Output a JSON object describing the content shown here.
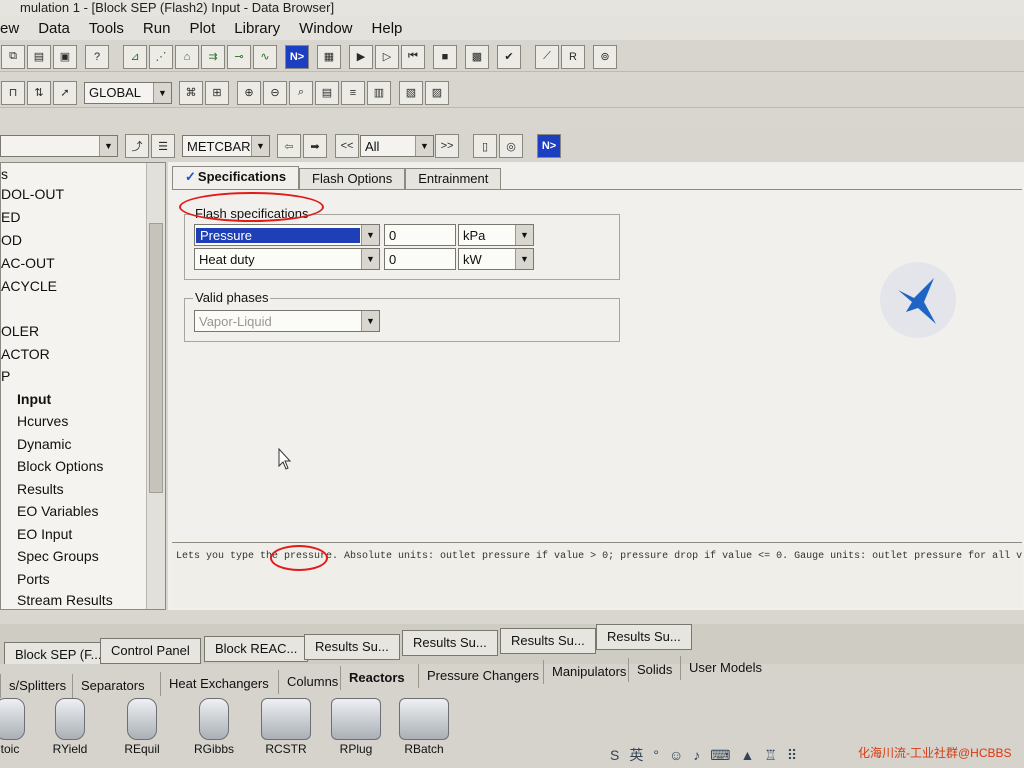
{
  "window": {
    "title": "mulation 1 - [Block SEP (Flash2) Input - Data Browser]"
  },
  "menu": [
    "ew",
    "Data",
    "Tools",
    "Run",
    "Plot",
    "Library",
    "Window",
    "Help"
  ],
  "toolbar": {
    "scope_value": "GLOBAL"
  },
  "navbar": {
    "units_value": "METCBAR",
    "filter_value": "All",
    "back_label": "<<",
    "forward_label": ">>",
    "next_label": "N>"
  },
  "tree": {
    "items": [
      {
        "label": "s",
        "sub": false,
        "bold": false
      },
      {
        "label": "DOL-OUT",
        "sub": false,
        "bold": false
      },
      {
        "label": "ED",
        "sub": false,
        "bold": false
      },
      {
        "label": "OD",
        "sub": false,
        "bold": false
      },
      {
        "label": "AC-OUT",
        "sub": false,
        "bold": false
      },
      {
        "label": "ACYCLE",
        "sub": false,
        "bold": false
      },
      {
        "label": "",
        "sub": false,
        "bold": false
      },
      {
        "label": "OLER",
        "sub": false,
        "bold": false
      },
      {
        "label": "ACTOR",
        "sub": false,
        "bold": false
      },
      {
        "label": "P",
        "sub": false,
        "bold": false
      },
      {
        "label": "Input",
        "sub": true,
        "bold": true
      },
      {
        "label": "Hcurves",
        "sub": true,
        "bold": false
      },
      {
        "label": "Dynamic",
        "sub": true,
        "bold": false
      },
      {
        "label": "Block Options",
        "sub": true,
        "bold": false
      },
      {
        "label": "Results",
        "sub": true,
        "bold": false
      },
      {
        "label": "EO Variables",
        "sub": true,
        "bold": false
      },
      {
        "label": "EO Input",
        "sub": true,
        "bold": false
      },
      {
        "label": "Spec Groups",
        "sub": true,
        "bold": false
      },
      {
        "label": "Ports",
        "sub": true,
        "bold": false
      },
      {
        "label": "Stream Results",
        "sub": true,
        "bold": false
      }
    ]
  },
  "tabs": {
    "check": "✓",
    "specifications": "Specifications",
    "flash_options": "Flash Options",
    "entrainment": "Entrainment"
  },
  "flash_spec": {
    "group_label": "Flash specifications",
    "row1": {
      "spec": "Pressure",
      "value": "0",
      "unit": "kPa"
    },
    "row2": {
      "spec": "Heat duty",
      "value": "0",
      "unit": "kW"
    }
  },
  "valid_phases": {
    "group_label": "Valid phases",
    "value": "Vapor-Liquid"
  },
  "status_text": "Lets you type the pressure. Absolute units: outlet pressure if value > 0; pressure drop if value <= 0. Gauge units: outlet pressure for all values. See Help.",
  "window_tabs": [
    "Block SEP (F...",
    "Control Panel",
    "Block REAC...",
    "Results Su...",
    "Results Su...",
    "Results Su...",
    "Results Su..."
  ],
  "palette": {
    "categories": [
      "s/Splitters",
      "Separators",
      "Heat Exchangers",
      "Columns",
      "Reactors",
      "Pressure Changers",
      "Manipulators",
      "Solids",
      "User Models"
    ],
    "active_category": "Reactors",
    "models": [
      "toic",
      "RYield",
      "REquil",
      "RGibbs",
      "RCSTR",
      "RPlug",
      "RBatch"
    ]
  },
  "taskbar": {
    "ime": "英"
  },
  "watermark": "化海川流-工业社群@HCBBS"
}
